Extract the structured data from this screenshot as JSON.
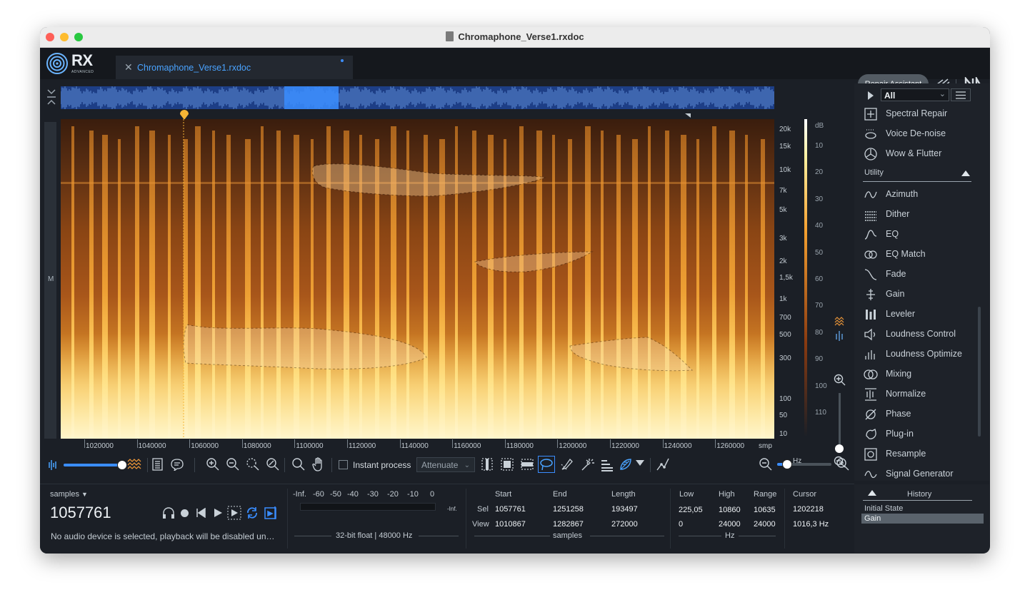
{
  "window": {
    "title": "Chromaphone_Verse1.rxdoc"
  },
  "app": {
    "logo": "RX",
    "edition": "ADVANCED"
  },
  "tab": {
    "label": "Chromaphone_Verse1.rxdoc"
  },
  "header": {
    "repair_assistant": "Repair Assistant"
  },
  "spectrogram": {
    "channel_label": "M",
    "freq_labels": [
      "20k",
      "15k",
      "10k",
      "7k",
      "5k",
      "3k",
      "2k",
      "1,5k",
      "1k",
      "700",
      "500",
      "300",
      "100",
      "50",
      "10"
    ],
    "freq_unit": "Hz",
    "db_title": "dB",
    "db_labels": [
      "10",
      "20",
      "30",
      "40",
      "50",
      "60",
      "70",
      "80",
      "90",
      "100",
      "110"
    ],
    "time_ticks": [
      "1020000",
      "1040000",
      "1060000",
      "1080000",
      "1100000",
      "1120000",
      "1140000",
      "1160000",
      "1180000",
      "1200000",
      "1220000",
      "1240000",
      "1260000"
    ],
    "time_unit": "smp"
  },
  "toolbar": {
    "instant_process": "Instant process",
    "attenuate": "Attenuate"
  },
  "transport": {
    "units": "samples",
    "position": "1057761",
    "status": "No audio device is selected, playback will be disabled un…"
  },
  "meter": {
    "scale": [
      "-Inf.",
      "-60",
      "-50",
      "-40",
      "-30",
      "-20",
      "-10",
      "0"
    ],
    "peak": "-Inf.",
    "format": "32-bit float | 48000 Hz"
  },
  "selection": {
    "headers": {
      "start": "Start",
      "end": "End",
      "length": "Length"
    },
    "sel": {
      "label": "Sel",
      "start": "1057761",
      "end": "1251258",
      "length": "193497"
    },
    "view": {
      "label": "View",
      "start": "1010867",
      "end": "1282867",
      "length": "272000"
    },
    "unit": "samples"
  },
  "frequency": {
    "headers": {
      "low": "Low",
      "high": "High",
      "range": "Range"
    },
    "row1": {
      "low": "225,05",
      "high": "10860",
      "range": "10635"
    },
    "row2": {
      "low": "0",
      "high": "24000",
      "range": "24000"
    },
    "unit": "Hz"
  },
  "cursor": {
    "label": "Cursor",
    "samples": "1202218",
    "hz": "1016,3 Hz"
  },
  "modules": {
    "filter": "All",
    "top_items": [
      {
        "label": "Spectral Repair",
        "icon": "spectral-repair-icon"
      },
      {
        "label": "Voice De-noise",
        "icon": "voice-denoise-icon"
      },
      {
        "label": "Wow & Flutter",
        "icon": "wow-flutter-icon"
      }
    ],
    "group": "Utility",
    "items": [
      {
        "label": "Azimuth",
        "icon": "azimuth-icon"
      },
      {
        "label": "Dither",
        "icon": "dither-icon"
      },
      {
        "label": "EQ",
        "icon": "eq-icon"
      },
      {
        "label": "EQ Match",
        "icon": "eq-match-icon"
      },
      {
        "label": "Fade",
        "icon": "fade-icon"
      },
      {
        "label": "Gain",
        "icon": "gain-icon"
      },
      {
        "label": "Leveler",
        "icon": "leveler-icon"
      },
      {
        "label": "Loudness Control",
        "icon": "loudness-control-icon"
      },
      {
        "label": "Loudness Optimize",
        "icon": "loudness-optimize-icon"
      },
      {
        "label": "Mixing",
        "icon": "mixing-icon"
      },
      {
        "label": "Normalize",
        "icon": "normalize-icon"
      },
      {
        "label": "Phase",
        "icon": "phase-icon"
      },
      {
        "label": "Plug-in",
        "icon": "plugin-icon"
      },
      {
        "label": "Resample",
        "icon": "resample-icon"
      },
      {
        "label": "Signal Generator",
        "icon": "signal-generator-icon"
      }
    ]
  },
  "history": {
    "title": "History",
    "items": [
      "Initial State",
      "Gain"
    ]
  },
  "colors": {
    "accent": "#3a8dff",
    "tab_text": "#4aa3ff",
    "playhead": "#f5b535"
  }
}
